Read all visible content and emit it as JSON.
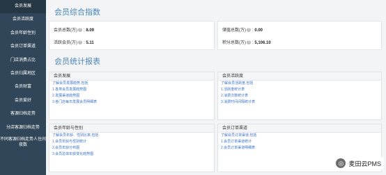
{
  "sidebar": {
    "items": [
      {
        "label": "会员发展"
      },
      {
        "label": "会员活跃度"
      },
      {
        "label": "会员年龄性别"
      },
      {
        "label": "会员订单渠道"
      },
      {
        "label": "门店消费占比"
      },
      {
        "label": "会员归属地区"
      },
      {
        "label": "会员财富"
      },
      {
        "label": "会员爱好"
      },
      {
        "label": "客源归档走势"
      },
      {
        "label": "分店客源归档走势"
      },
      {
        "label": "不同客源归档走势人住间夜数"
      }
    ]
  },
  "overview": {
    "title": "会员综合指数",
    "metrics": [
      {
        "label": "会员总数(万)",
        "value": "8.09"
      },
      {
        "label": "储值总数(万)",
        "value": "0.00"
      },
      {
        "label": "活跃会员(万)",
        "value": "5.11"
      },
      {
        "label": "积分总数(万)",
        "value": "5,106.10"
      }
    ]
  },
  "reports": {
    "title": "会员统计报表",
    "panels": [
      {
        "title": "会员发展",
        "links": [
          "了解会员发展趋势,包括",
          "1.各类会员发展趋势图",
          "2.发展渠道趋势图",
          "3.各门店每日发展会员明细表"
        ]
      },
      {
        "title": "会员活跃度",
        "links": [
          "了解会员活跃度,包括",
          "1.活跃度统计表",
          "2.消费次数统计表",
          "3.消费时间间隔统计表"
        ]
      },
      {
        "title": "会员年龄与性别",
        "links": [
          "了解会员年龄、性别比率,包括",
          "1.会员年龄与性别统计",
          "2.会员年龄分布图",
          "3.会员总体年龄变化趋势图"
        ]
      },
      {
        "title": "会员订单渠道",
        "links": [
          "了解会员订单渠道,包括",
          "1.会员订单渠道统计",
          "2.会员订单渠道明细表"
        ]
      }
    ]
  },
  "watermark": {
    "text": "麦田云PMS"
  }
}
